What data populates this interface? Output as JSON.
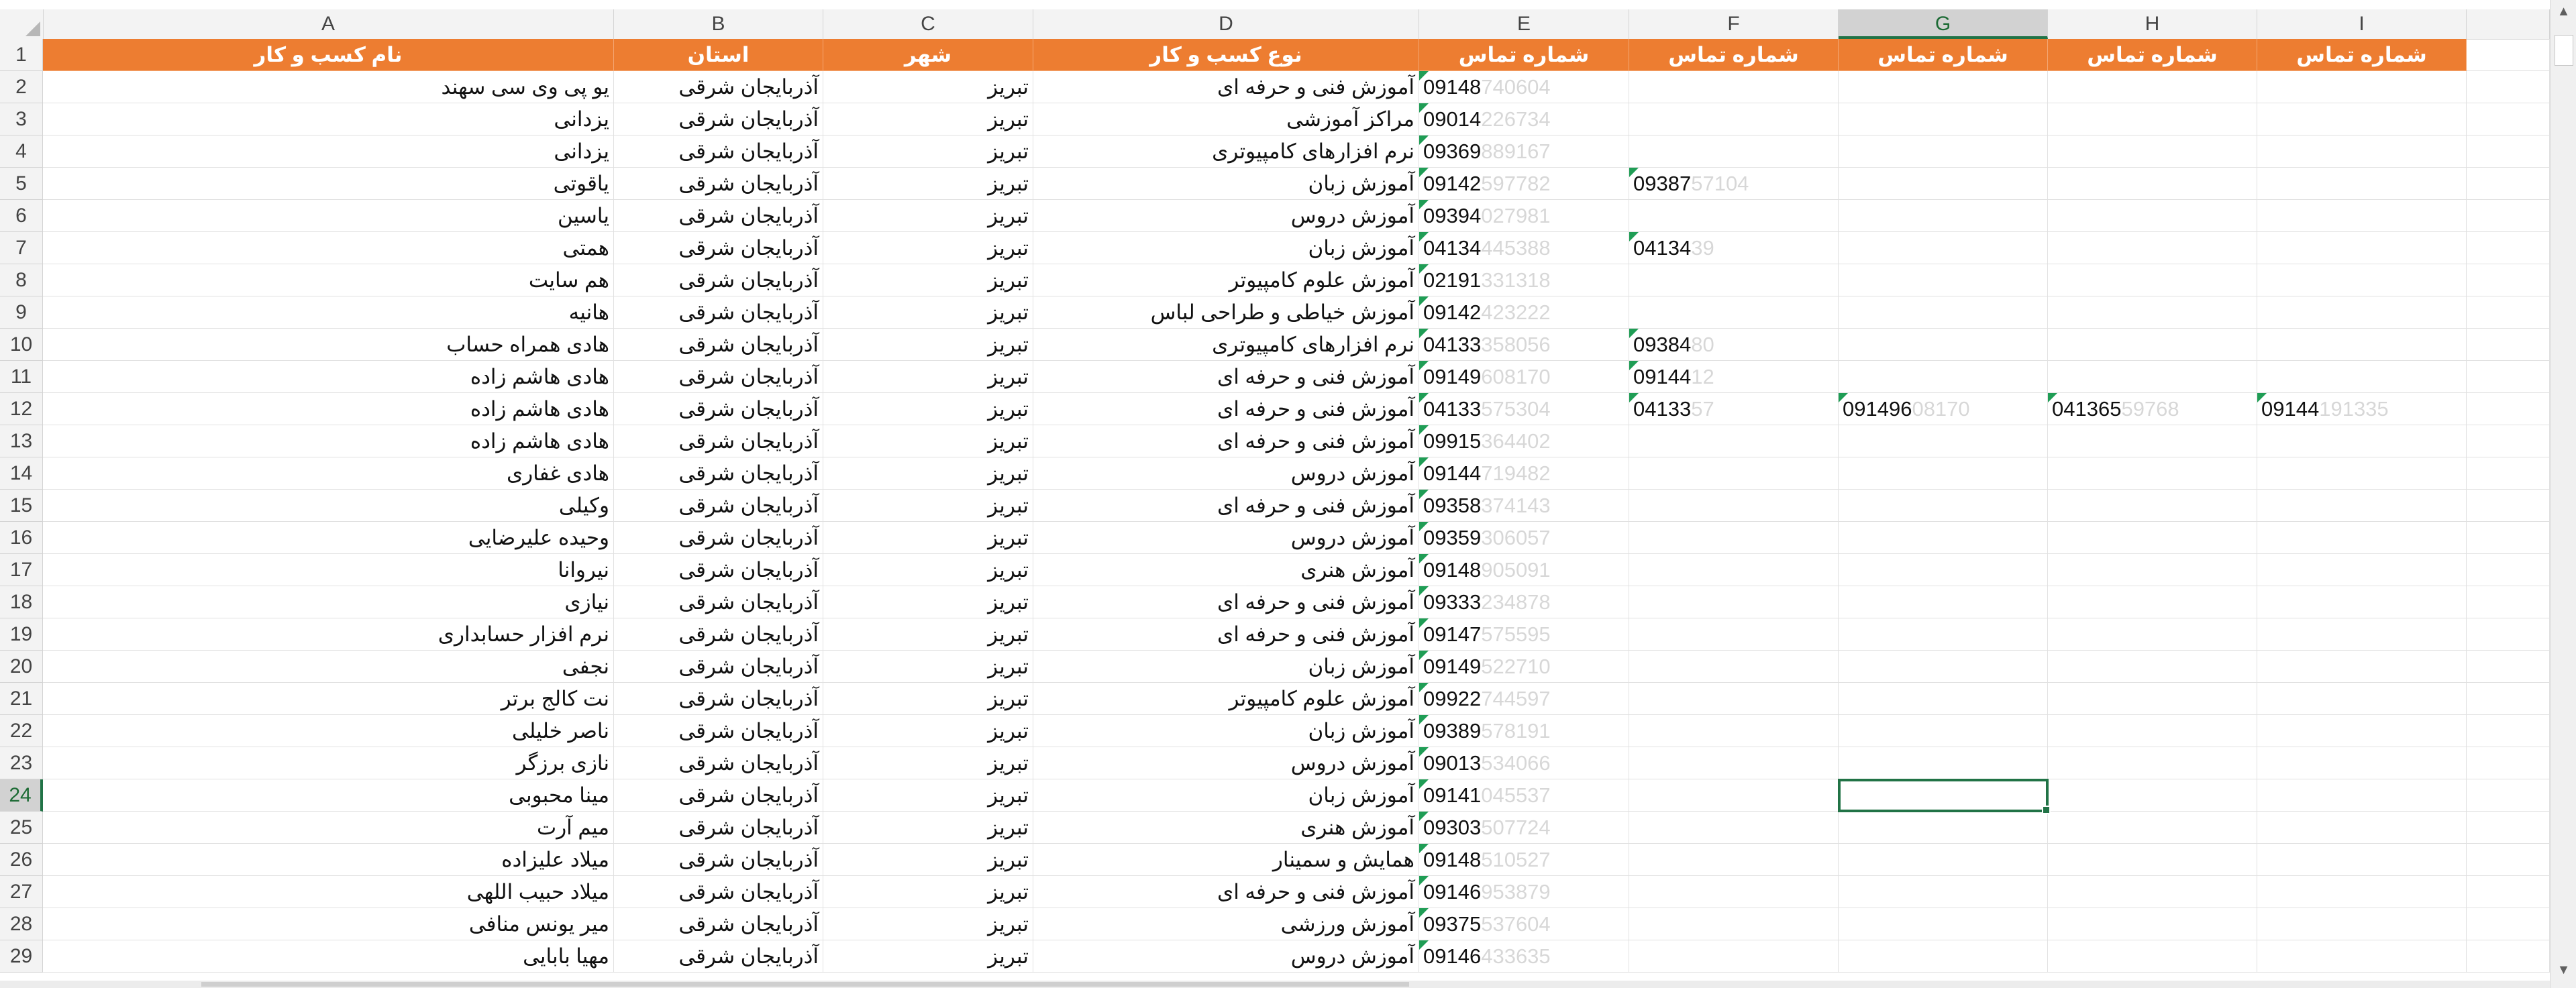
{
  "columns": [
    "A",
    "B",
    "C",
    "D",
    "E",
    "F",
    "G",
    "H",
    "I"
  ],
  "selected_column": "G",
  "selected_row": "24",
  "header_row": {
    "row_number": "1",
    "A": "نام کسب و کار",
    "B": "استان",
    "C": "شهر",
    "D": "نوع کسب و کار",
    "E": "شماره تماس",
    "F": "شماره تماس",
    "G": "شماره تماس",
    "H": "شماره تماس",
    "I": "شماره تماس"
  },
  "rows": [
    {
      "n": "2",
      "A": "یو پی وی سی سهند",
      "B": "آذربایجان شرقی",
      "C": "تبریز",
      "D": "آموزش فنی و حرفه ای",
      "E": "09148",
      "E_hidden": "740604"
    },
    {
      "n": "3",
      "A": "یزدانی",
      "B": "آذربایجان شرقی",
      "C": "تبریز",
      "D": "مراکز آموزشی",
      "E": "09014",
      "E_hidden": "226734"
    },
    {
      "n": "4",
      "A": "یزدانی",
      "B": "آذربایجان شرقی",
      "C": "تبریز",
      "D": "نرم افزارهای کامپیوتری",
      "E": "09369",
      "E_hidden": "889167"
    },
    {
      "n": "5",
      "A": "یاقوتی",
      "B": "آذربایجان شرقی",
      "C": "تبریز",
      "D": "آموزش زبان",
      "E": "09142",
      "E_hidden": "597782",
      "F": "09387",
      "F_hidden": "57104"
    },
    {
      "n": "6",
      "A": "یاسین",
      "B": "آذربایجان شرقی",
      "C": "تبریز",
      "D": "آموزش دروس",
      "E": "09394",
      "E_hidden": "027981"
    },
    {
      "n": "7",
      "A": "همتی",
      "B": "آذربایجان شرقی",
      "C": "تبریز",
      "D": "آموزش زبان",
      "E": "04134",
      "E_hidden": "445388",
      "F": "04134",
      "F_hidden": "39"
    },
    {
      "n": "8",
      "A": "هم سایت",
      "B": "آذربایجان شرقی",
      "C": "تبریز",
      "D": "آموزش علوم کامپیوتر",
      "E": "02191",
      "E_hidden": "331318"
    },
    {
      "n": "9",
      "A": "هانیه",
      "B": "آذربایجان شرقی",
      "C": "تبریز",
      "D": "آموزش خیاطی و طراحی لباس",
      "E": "09142",
      "E_hidden": "423222"
    },
    {
      "n": "10",
      "A": "هادی همراه حساب",
      "B": "آذربایجان شرقی",
      "C": "تبریز",
      "D": "نرم افزارهای کامپیوتری",
      "E": "04133",
      "E_hidden": "358056",
      "F": "09384",
      "F_hidden": "80"
    },
    {
      "n": "11",
      "A": "هادی هاشم زاده",
      "B": "آذربایجان شرقی",
      "C": "تبریز",
      "D": "آموزش فنی و حرفه ای",
      "E": "09149",
      "E_hidden": "608170",
      "F": "09144",
      "F_hidden": "12"
    },
    {
      "n": "12",
      "A": "هادی هاشم زاده",
      "B": "آذربایجان شرقی",
      "C": "تبریز",
      "D": "آموزش فنی و حرفه ای",
      "E": "04133",
      "E_hidden": "575304",
      "F": "04133",
      "F_hidden": "57",
      "G": "091496",
      "G_hidden": "08170",
      "H": "041365",
      "H_hidden": "59768",
      "I": "09144",
      "I_hidden": "191335"
    },
    {
      "n": "13",
      "A": "هادی هاشم زاده",
      "B": "آذربایجان شرقی",
      "C": "تبریز",
      "D": "آموزش فنی و حرفه ای",
      "E": "09915",
      "E_hidden": "364402"
    },
    {
      "n": "14",
      "A": "هادی غفاری",
      "B": "آذربایجان شرقی",
      "C": "تبریز",
      "D": "آموزش دروس",
      "E": "09144",
      "E_hidden": "719482"
    },
    {
      "n": "15",
      "A": "وکیلی",
      "B": "آذربایجان شرقی",
      "C": "تبریز",
      "D": "آموزش فنی و حرفه ای",
      "E": "09358",
      "E_hidden": "374143"
    },
    {
      "n": "16",
      "A": "وحیده علیرضایی",
      "B": "آذربایجان شرقی",
      "C": "تبریز",
      "D": "آموزش دروس",
      "E": "09359",
      "E_hidden": "306057"
    },
    {
      "n": "17",
      "A": "نیروانا",
      "B": "آذربایجان شرقی",
      "C": "تبریز",
      "D": "آموزش هنری",
      "E": "09148",
      "E_hidden": "905091"
    },
    {
      "n": "18",
      "A": "نیازی",
      "B": "آذربایجان شرقی",
      "C": "تبریز",
      "D": "آموزش فنی و حرفه ای",
      "E": "09333",
      "E_hidden": "234878"
    },
    {
      "n": "19",
      "A": "نرم افزار حسابداری",
      "B": "آذربایجان شرقی",
      "C": "تبریز",
      "D": "آموزش فنی و حرفه ای",
      "E": "09147",
      "E_hidden": "575595"
    },
    {
      "n": "20",
      "A": "نجفی",
      "B": "آذربایجان شرقی",
      "C": "تبریز",
      "D": "آموزش زبان",
      "E": "09149",
      "E_hidden": "522710"
    },
    {
      "n": "21",
      "A": "نت کالج برتر",
      "B": "آذربایجان شرقی",
      "C": "تبریز",
      "D": "آموزش علوم کامپیوتر",
      "E": "09922",
      "E_hidden": "744597"
    },
    {
      "n": "22",
      "A": "ناصر خلیلی",
      "B": "آذربایجان شرقی",
      "C": "تبریز",
      "D": "آموزش زبان",
      "E": "09389",
      "E_hidden": "578191"
    },
    {
      "n": "23",
      "A": "نازی برزگر",
      "B": "آذربایجان شرقی",
      "C": "تبریز",
      "D": "آموزش دروس",
      "E": "09013",
      "E_hidden": "534066"
    },
    {
      "n": "24",
      "A": "مینا محبوبی",
      "B": "آذربایجان شرقی",
      "C": "تبریز",
      "D": "آموزش زبان",
      "E": "09141",
      "E_hidden": "045537"
    },
    {
      "n": "25",
      "A": "میم آرت",
      "B": "آذربایجان شرقی",
      "C": "تبریز",
      "D": "آموزش هنری",
      "E": "09303",
      "E_hidden": "507724"
    },
    {
      "n": "26",
      "A": "میلاد علیزاده",
      "B": "آذربایجان شرقی",
      "C": "تبریز",
      "D": "همایش و سمینار",
      "E": "09148",
      "E_hidden": "510527"
    },
    {
      "n": "27",
      "A": "میلاد حبیب اللهی",
      "B": "آذربایجان شرقی",
      "C": "تبریز",
      "D": "آموزش فنی و حرفه ای",
      "E": "09146",
      "E_hidden": "953879"
    },
    {
      "n": "28",
      "A": "میر یونس منافی",
      "B": "آذربایجان شرقی",
      "C": "تبریز",
      "D": "آموزش ورزشی",
      "E": "09375",
      "E_hidden": "537604"
    },
    {
      "n": "29",
      "A": "مهیا بابایی",
      "B": "آذربایجان شرقی",
      "C": "تبریز",
      "D": "آموزش دروس",
      "E": "09146",
      "E_hidden": "433635"
    }
  ],
  "colors": {
    "header_fill": "#ed7d31",
    "header_text": "#ffffff",
    "selection": "#217346",
    "error_flag": "#1f9d55"
  }
}
